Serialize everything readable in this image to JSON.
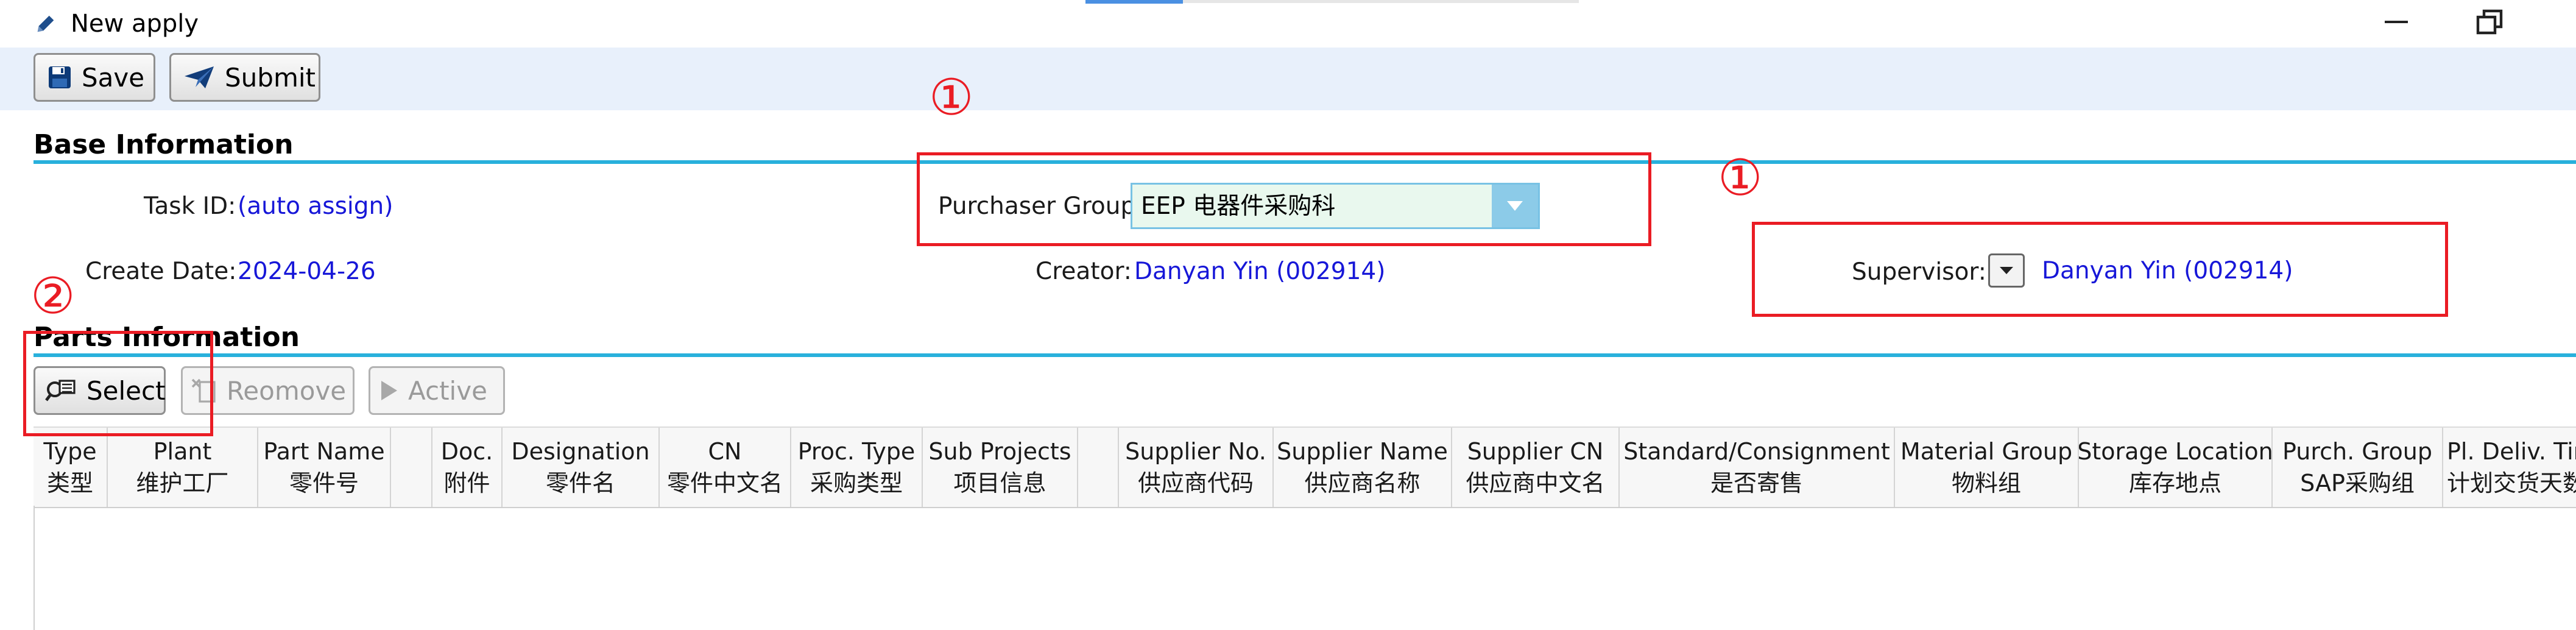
{
  "window": {
    "title": "New apply"
  },
  "toolbar": {
    "save_label": "Save",
    "submit_label": "Submit"
  },
  "base_info": {
    "section_title": "Base Information",
    "task_id_label": "Task ID:",
    "task_id_value": "(auto assign)",
    "create_date_label": "Create Date:",
    "create_date_value": "2024-04-26",
    "purchaser_group_label": "Purchaser Group:",
    "purchaser_group_value": "EEP 电器件采购科",
    "creator_label": "Creator:",
    "creator_value": "Danyan Yin (002914)",
    "supervisor_label": "Supervisor:",
    "supervisor_value": "Danyan Yin (002914)"
  },
  "parts_info": {
    "section_title": "Parts Information",
    "select_label": "Select",
    "remove_label": "Reomove",
    "active_label": "Active",
    "columns": [
      {
        "en": "Type",
        "cn": "类型"
      },
      {
        "en": "Plant",
        "cn": "维护工厂"
      },
      {
        "en": "Part Name",
        "cn": "零件号"
      },
      {
        "en": "",
        "cn": ""
      },
      {
        "en": "Doc.",
        "cn": "附件"
      },
      {
        "en": "Designation",
        "cn": "零件名"
      },
      {
        "en": "CN",
        "cn": "零件中文名"
      },
      {
        "en": "Proc. Type",
        "cn": "采购类型"
      },
      {
        "en": "Sub Projects",
        "cn": "项目信息"
      },
      {
        "en": "",
        "cn": ""
      },
      {
        "en": "Supplier No.",
        "cn": "供应商代码"
      },
      {
        "en": "Supplier Name",
        "cn": "供应商名称"
      },
      {
        "en": "Supplier CN",
        "cn": "供应商中文名"
      },
      {
        "en": "Standard/Consignment",
        "cn": "是否寄售"
      },
      {
        "en": "Material Group",
        "cn": "物料组"
      },
      {
        "en": "Storage Location",
        "cn": "库存地点"
      },
      {
        "en": "Purch. Group",
        "cn": "SAP采购组"
      },
      {
        "en": "Pl. Deliv. Time",
        "cn": "计划交货天数"
      }
    ]
  },
  "annotations": {
    "marker_1": "①",
    "marker_2": "②"
  },
  "colors": {
    "accent_rule": "#28b0dc",
    "link_value": "#1717d8",
    "annotation_red": "#ea1c24",
    "toolbar_bg": "#e8f0fb"
  }
}
